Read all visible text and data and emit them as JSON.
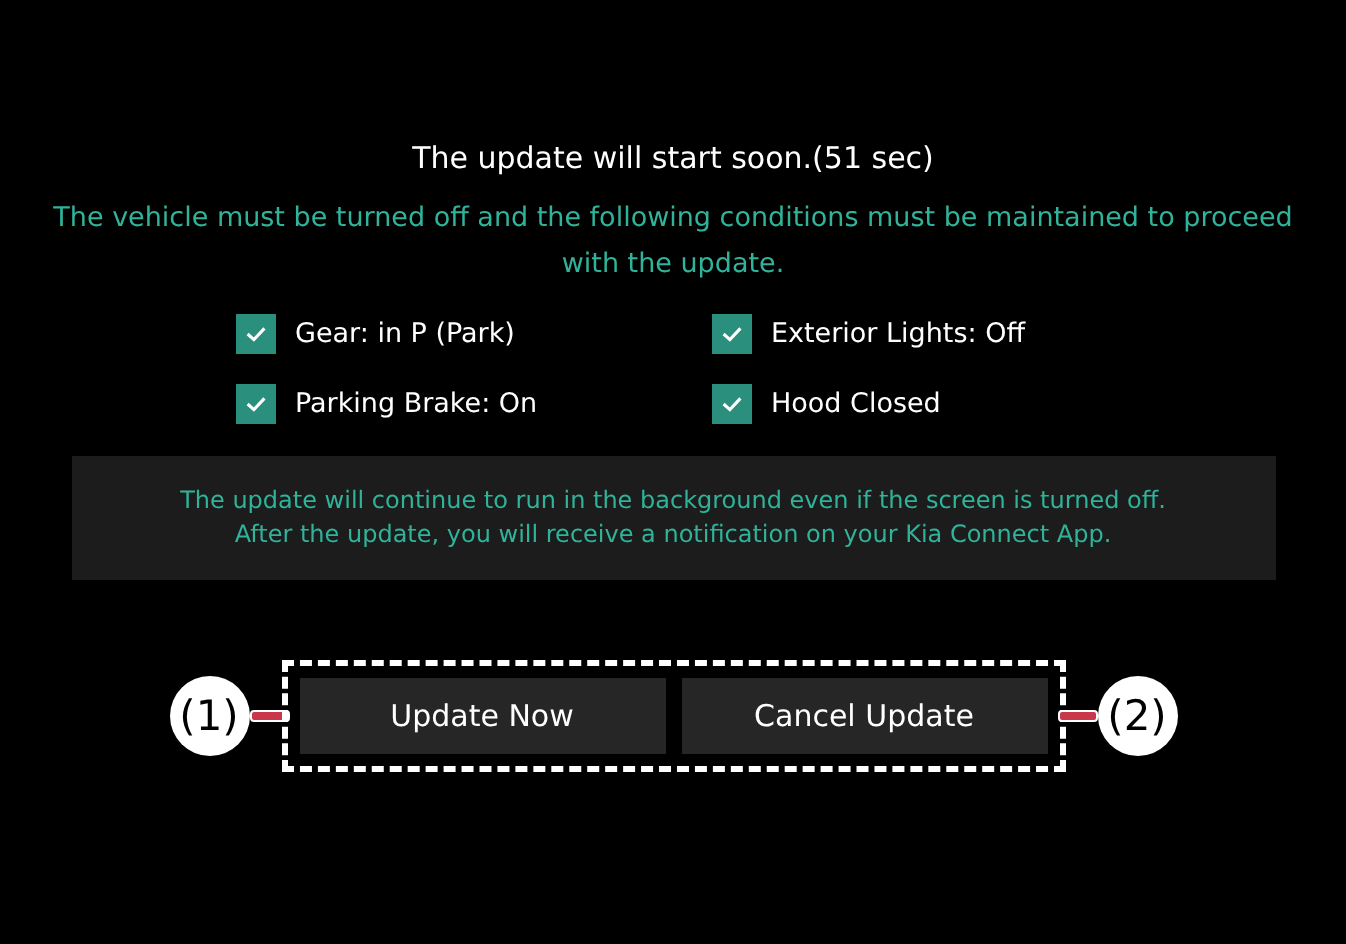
{
  "title": "The update will start soon.(51 sec)",
  "notice": "The vehicle must be turned off and the following conditions must be maintained to proceed with the update.",
  "conditions": [
    {
      "label": "Gear: in P (Park)",
      "checked": true
    },
    {
      "label": "Exterior Lights: Off",
      "checked": true
    },
    {
      "label": "Parking Brake: On",
      "checked": true
    },
    {
      "label": "Hood Closed",
      "checked": true
    }
  ],
  "info": [
    "The update will continue to run in the background even if the screen is turned off.",
    "After the update, you will receive a notification on your Kia Connect App."
  ],
  "buttons": [
    "Update Now",
    "Cancel Update"
  ],
  "callouts": [
    "(1)",
    "(2)"
  ]
}
